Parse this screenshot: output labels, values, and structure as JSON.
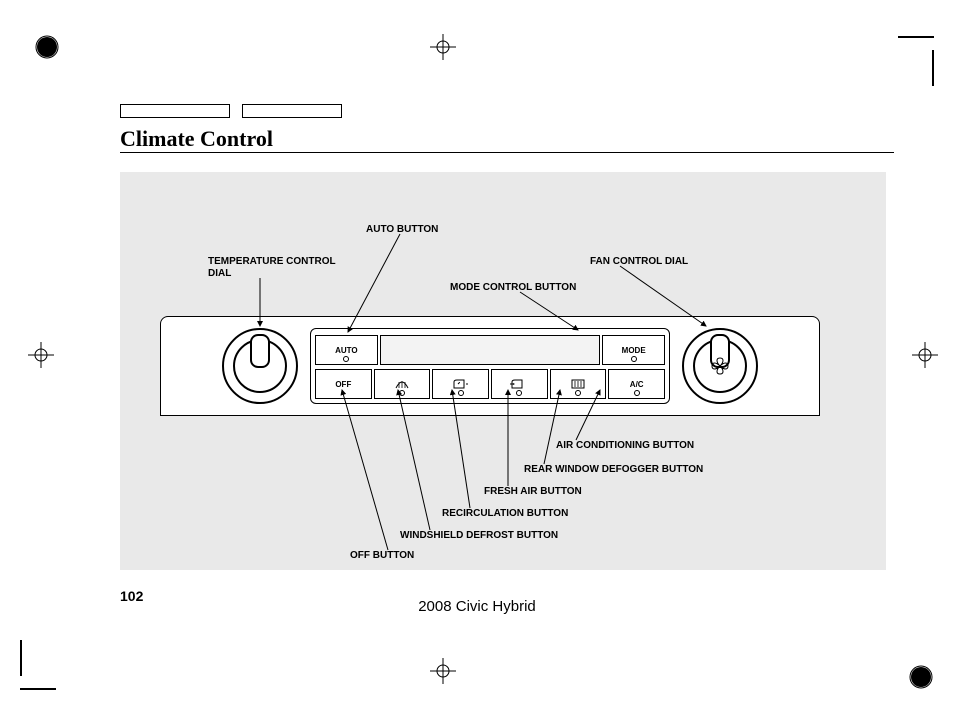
{
  "page_title": "Climate Control",
  "page_number": "102",
  "footer": "2008  Civic  Hybrid",
  "panel": {
    "auto_label": "AUTO",
    "mode_label": "MODE",
    "off_label": "OFF",
    "ac_label": "A/C"
  },
  "callouts": {
    "auto_button": "AUTO BUTTON",
    "temp_dial": "TEMPERATURE CONTROL\nDIAL",
    "mode_button": "MODE CONTROL BUTTON",
    "fan_dial": "FAN CONTROL DIAL",
    "ac_button": "AIR CONDITIONING BUTTON",
    "rear_defog": "REAR WINDOW DEFOGGER BUTTON",
    "fresh_air": "FRESH AIR BUTTON",
    "recirc": "RECIRCULATION BUTTON",
    "ws_defrost": "WINDSHIELD DEFROST BUTTON",
    "off_button": "OFF BUTTON"
  }
}
